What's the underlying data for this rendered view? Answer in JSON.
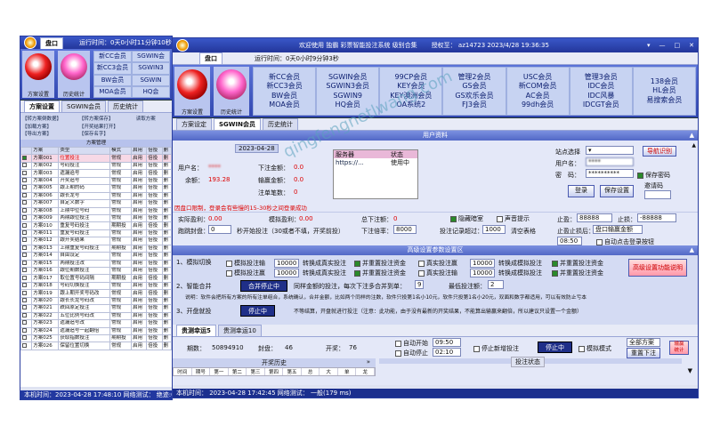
{
  "back": {
    "tab_home": "盘口",
    "run_time": "运行时间：0天0小时11分钟10秒",
    "grid": [
      [
        "新CC会员",
        "SGWIN会"
      ],
      [
        "新CC3会员",
        "SGWIN3"
      ],
      [
        "BW会员",
        "SGWIN"
      ],
      [
        "MOA会员",
        "HQ会"
      ]
    ],
    "app1": "方案设置",
    "app2": "历史统计",
    "tabs": [
      "方案设置",
      "SGWIN会员",
      "历史统计"
    ],
    "plan_box": [
      "【转方案倒数据】",
      "【转方案保存】",
      "【加载方案】",
      "【开奖结果打开】",
      "【导出方案】",
      "【保存名字】"
    ],
    "load_label": "读取方案",
    "scheme_header": "方案管理",
    "cols": [
      "方案",
      "类型",
      "模式",
      "启用",
      "倍投",
      "删"
    ],
    "rows": [
      [
        "方案001",
        "位置投注",
        "常规",
        "启用",
        "倍投",
        "删"
      ],
      [
        "方案002",
        "号码投注",
        "常规",
        "启用",
        "倍投",
        "删"
      ],
      [
        "方案003",
        "遗漏追号",
        "常规",
        "启用",
        "倍投",
        "删"
      ],
      [
        "方案004",
        "开奖追号",
        "常规",
        "启用",
        "倍投",
        "删"
      ],
      [
        "方案005",
        "跟上期的码",
        "常规",
        "启用",
        "倍投",
        "删"
      ],
      [
        "方案006",
        "跟长龙号",
        "常规",
        "启用",
        "倍投",
        "删"
      ],
      [
        "方案007",
        "自定义数字",
        "常规",
        "启用",
        "倍投",
        "删"
      ],
      [
        "方案008",
        "上期中位号码",
        "常规",
        "启用",
        "倍投",
        "删"
      ],
      [
        "方案009",
        "两期跟位投注",
        "常规",
        "启用",
        "倍投",
        "删"
      ],
      [
        "方案010",
        "重复号码投注",
        "期期投",
        "启用",
        "倍投",
        "删"
      ],
      [
        "方案011",
        "重复号码投注",
        "常规",
        "启用",
        "倍投",
        "删"
      ],
      [
        "方案012",
        "跟开奖结果",
        "常规",
        "启用",
        "倍投",
        "删"
      ],
      [
        "方案013",
        "上期重复号码投注",
        "期期投",
        "启用",
        "倍投",
        "删"
      ],
      [
        "方案014",
        "自由设定",
        "常规",
        "启用",
        "倍投",
        "删"
      ],
      [
        "方案015",
        "两期投注改",
        "常规",
        "启用",
        "倍投",
        "删"
      ],
      [
        "方案016",
        "跟位期数投注",
        "常规",
        "启用",
        "倍投",
        "删"
      ],
      [
        "方案017",
        "取位置号码间隔",
        "期期投",
        "启用",
        "倍投",
        "删"
      ],
      [
        "方案018",
        "号码切换投注",
        "常规",
        "启用",
        "倍投",
        "删"
      ],
      [
        "方案019",
        "跟上期开奖号码改",
        "常规",
        "启用",
        "倍投",
        "删"
      ],
      [
        "方案020",
        "跟长长龙号码改",
        "常规",
        "启用",
        "倍投",
        "删"
      ],
      [
        "方案021",
        "跌回原定投注",
        "常规",
        "启用",
        "倍投",
        "删"
      ],
      [
        "方案022",
        "五位比例号码改",
        "常规",
        "启用",
        "倍投",
        "删"
      ],
      [
        "方案023",
        "遗漏追号改",
        "常规",
        "启用",
        "倍投",
        "删"
      ],
      [
        "方案024",
        "遗漏追号一起翻倍",
        "常规",
        "启用",
        "倍投",
        "删"
      ],
      [
        "方案025",
        "获取指数投注",
        "期期投",
        "启用",
        "倍投",
        "删"
      ],
      [
        "方案026",
        "保留位置切换",
        "常规",
        "启用",
        "倍投",
        "删"
      ]
    ],
    "status": "本机时间：2023-04-28 17:48:10  网络测试：   绝迹:0/0"
  },
  "main": {
    "title": "欢迎使用 独霸 彩票智能投注系统 级别合集",
    "auth": "授权至： az14723   2023/4/28 19:36:35",
    "tab_home": "盘口",
    "run_time": "运行时间：0天0小时9分钟3秒",
    "app1": "方案设置",
    "app2": "历史统计",
    "grid": [
      [
        "新CC会员",
        "新CC3会员",
        "BW会员",
        "MOA会员"
      ],
      [
        "SGWIN会员",
        "SGWIN3会员",
        "SGWIN9",
        "HQ会员"
      ],
      [
        "99CP会员",
        "KEY会员",
        "KEY澳洲会员",
        "OA系统2"
      ],
      [
        "管理2会员",
        "GS会员",
        "GS欢乐会员",
        "FJ3会员"
      ],
      [
        "USC会员",
        "新COM会员",
        "AC会员",
        "99dh会员"
      ],
      [
        "管理3会员",
        "IDC会员",
        "IDC风暴",
        "IDCGT会员"
      ],
      [
        "138会员",
        "HL会员",
        "易搜索会员",
        ""
      ]
    ],
    "tabs": [
      "方案设定",
      "SGWIN会员",
      "历史统计"
    ],
    "user_hdr": "用户资料",
    "date": "2023-04-28",
    "username_l": "用户名：",
    "username_v": "****",
    "balance_l": "余额：",
    "balance_v": "193.28",
    "under_l": "下注金额：",
    "under_v": "0.0",
    "lose_l": "输赢金额：",
    "lose_v": "0.0",
    "notes_l": "注单笔数：",
    "notes_v": "0",
    "server_l": "服务器",
    "status_l": "状态",
    "server_v": "https://...",
    "server_s": "使用中",
    "site_l": "站点选择",
    "user2_l": "用户名：",
    "user2_v": "****",
    "pwd_l": "密　码：",
    "pwd_v": "**********",
    "nav_l": "导航识别",
    "savepwd_l": "保存密码",
    "login_btn": "登录",
    "savecfg_btn": "保存设置",
    "invite_l": "邀请码",
    "warn": "因盘口限制，登录会有些慢的15-30秒之间登录成功",
    "real_l": "实际盈利：",
    "real_v": "0.00",
    "sim_l": "模拟盈利：",
    "sim_v": "0.00",
    "totalnote_l": "总下注额：",
    "totalnote_v": "0",
    "hide_l": "隐藏暗室",
    "sound_l": "声音提示",
    "stop_l": "止盈：",
    "stop_v": "88888",
    "loss_l": "止损：",
    "loss_v": "-88888",
    "gap_l": "跑跳封盘：",
    "gap_v": "0",
    "gap_desc": "秒开始投注（30或者不填，开奖前投）",
    "rate_l": "下注倍率：",
    "rate_v": "8000",
    "rec_l": "投注记录超过：",
    "rec_v": "1000",
    "rec_desc": "清空表格",
    "after_l": "止盈止损后：",
    "after_v": "盘口输赢金额",
    "time_v": "08:50",
    "autostop_l": "自动点击登录按钮",
    "adv_hdr": "高级设置参数设置区",
    "s1": "1、模拟切换",
    "s1a": "模拟投注输",
    "n1": "10000",
    "s1b": "转换成真实投注",
    "s1c": "并重置投注资金",
    "s1d": "真实投注赢",
    "n2": "10000",
    "s1e": "转换成模拟投注",
    "s1f": "并重置投注资金",
    "s1g": "模拟投注赢",
    "n3": "10000",
    "s1h": "转换成真实投注",
    "s1i": "并重置投注资金",
    "s1j": "真实投注输",
    "n4": "10000",
    "s1k": "转换成模拟投注",
    "s1l": "并重置投注资金",
    "adv_btn": "高级设置功能说明",
    "s2": "2、智能合并",
    "merge_btn": "合并停止中",
    "s2a": "同样金额的投注，每次下注多合并到单：",
    "s2v": "9",
    "s2b": "最低投注额：",
    "s2bv": "2",
    "s2desc": "说明：软件会把所有方案的所有注单组合，系统确认，合并金额，比如两个同样的注数，软件只投第1名小10元，软件只投第1名小20元，双面和数字都适用，可以有效防止亏本",
    "s3": "3、开盘就投",
    "stop_btn": "停止中",
    "s3desc": "不等结算，开盘就进行投注（注意：此功能，由于没有最新的开奖结果，不能算出输赢来翻倍，所以建议只设置一个金额）",
    "sub_tabs": [
      "贵测幸运5",
      "贵测幸运10"
    ],
    "period_l": "期数：",
    "period_v": "50894910",
    "close_l": "封盘：",
    "close_v": "46",
    "open_l": "开奖：",
    "open_v": "76",
    "autostart_l": "自动开始",
    "autostart_v": "09:50",
    "autostop2_l": "自动停止",
    "autostop2_v": "02:10",
    "nobet_l": "停止新增投注",
    "stop2_btn": "停止中",
    "simmode_l": "模拟模式",
    "plan_sel": "全部方案",
    "reset_btn": "重置下注",
    "stats_l": "输赢统计",
    "hist_l": "开奖历史",
    "betstate_l": "投注状态",
    "hist_cols": [
      "时间",
      "期号",
      "第一",
      "第二",
      "第三",
      "第四",
      "第五",
      "总",
      "大",
      "单",
      "龙"
    ],
    "status": "本机时间：  2023-04-28 17:42:45  网络测试：  一般(179 ms)"
  },
  "watermark": "qingfengnetlwang.com"
}
